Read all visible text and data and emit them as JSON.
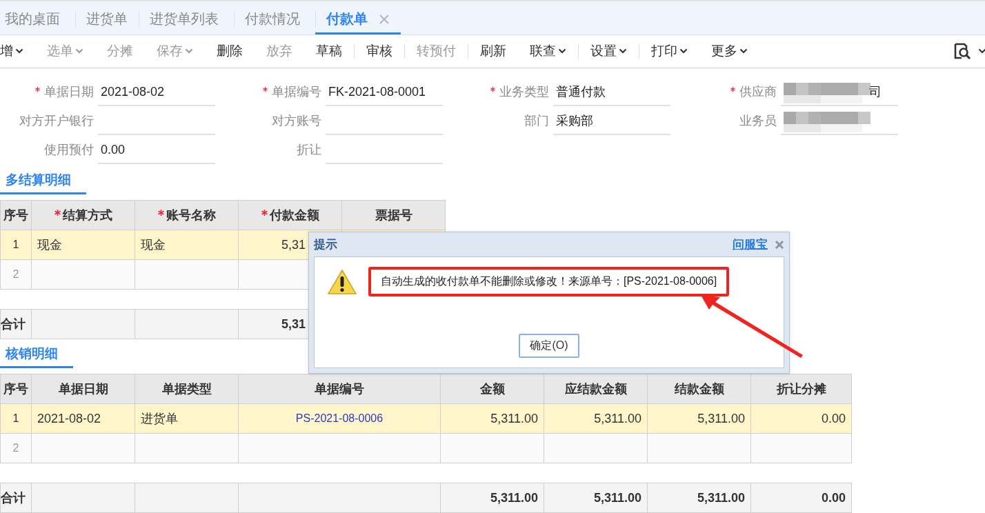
{
  "tabs": [
    {
      "label": "我的桌面",
      "selected": false,
      "closable": false
    },
    {
      "label": "进货单",
      "selected": false,
      "closable": false
    },
    {
      "label": "进货单列表",
      "selected": false,
      "closable": false
    },
    {
      "label": "付款情况",
      "selected": false,
      "closable": false
    },
    {
      "label": "付款单",
      "selected": true,
      "closable": true
    }
  ],
  "toolbar": {
    "items": [
      {
        "label": "增",
        "dropdown": true,
        "disabled": false,
        "separator_before": false
      },
      {
        "label": "选单",
        "dropdown": true,
        "disabled": true,
        "separator_before": false
      },
      {
        "label": "分摊",
        "dropdown": false,
        "disabled": true,
        "separator_before": false
      },
      {
        "label": "保存",
        "dropdown": true,
        "disabled": true,
        "separator_before": false
      },
      {
        "label": "删除",
        "dropdown": false,
        "disabled": false,
        "separator_before": false
      },
      {
        "label": "放弃",
        "dropdown": false,
        "disabled": true,
        "separator_before": false
      },
      {
        "label": "草稿",
        "dropdown": false,
        "disabled": false,
        "separator_before": false
      },
      {
        "label": "审核",
        "dropdown": false,
        "disabled": false,
        "separator_before": true
      },
      {
        "label": "转预付",
        "dropdown": false,
        "disabled": true,
        "separator_before": true
      },
      {
        "label": "刷新",
        "dropdown": false,
        "disabled": false,
        "separator_before": true
      },
      {
        "label": "联查",
        "dropdown": true,
        "disabled": false,
        "separator_before": false
      },
      {
        "label": "设置",
        "dropdown": true,
        "disabled": false,
        "separator_before": true
      },
      {
        "label": "打印",
        "dropdown": true,
        "disabled": false,
        "separator_before": true
      },
      {
        "label": "更多",
        "dropdown": true,
        "disabled": false,
        "separator_before": false
      }
    ]
  },
  "form": {
    "fields": [
      {
        "label": "单据日期",
        "required": true,
        "value": "2021-08-02",
        "redacted": false
      },
      {
        "label": "单据编号",
        "required": true,
        "value": "FK-2021-08-0001",
        "redacted": false
      },
      {
        "label": "业务类型",
        "required": true,
        "value": "普通付款",
        "redacted": false
      },
      {
        "label": "供应商",
        "required": true,
        "value": "司",
        "redacted": true
      },
      {
        "label": "对方开户银行",
        "required": false,
        "redacted": false
      },
      {
        "label": "对方账号",
        "required": false,
        "redacted": false
      },
      {
        "label": "部门",
        "required": false,
        "value": "采购部",
        "redacted": false
      },
      {
        "label": "业务员",
        "required": false,
        "redacted": true
      },
      {
        "label": "使用预付",
        "required": false,
        "value": "0.00",
        "redacted": false
      },
      {
        "label": "折让",
        "required": false,
        "redacted": false
      }
    ]
  },
  "sections": [
    {
      "title": "多结算明细",
      "columns": [
        {
          "label": "序号",
          "required": false,
          "kind": "index"
        },
        {
          "label": "结算方式",
          "required": true,
          "kind": "text"
        },
        {
          "label": "账号名称",
          "required": true,
          "kind": "text"
        },
        {
          "label": "付款金额",
          "required": true,
          "kind": "cut_amount"
        },
        {
          "label": "票据号",
          "required": false,
          "kind": "text"
        }
      ],
      "rows": [
        {
          "selected": true,
          "cells": [
            "1",
            "现金",
            "现金",
            "5,31"
          ]
        },
        {
          "selected": false,
          "cells": [
            "2"
          ]
        }
      ],
      "total": {
        "label": "合计",
        "amounts": [
          "5,31"
        ]
      }
    },
    {
      "title": "核销明细",
      "columns": [
        {
          "label": "序号",
          "required": false,
          "kind": "index"
        },
        {
          "label": "单据日期",
          "required": false,
          "kind": "text"
        },
        {
          "label": "单据类型",
          "required": false,
          "kind": "text"
        },
        {
          "label": "单据编号",
          "required": false,
          "kind": "link"
        },
        {
          "label": "金额",
          "required": false,
          "kind": "amount"
        },
        {
          "label": "应结款金额",
          "required": false,
          "kind": "amount"
        },
        {
          "label": "结款金额",
          "required": false,
          "kind": "amount"
        },
        {
          "label": "折让分摊",
          "required": false,
          "kind": "amount"
        }
      ],
      "rows": [
        {
          "selected": true,
          "cells": [
            "1",
            "2021-08-02",
            "进货单",
            "PS-2021-08-0006",
            "5,311.00",
            "5,311.00",
            "5,311.00",
            "0.00"
          ]
        },
        {
          "selected": false,
          "cells": [
            "2"
          ]
        }
      ],
      "total": {
        "label": "合计",
        "amounts": [
          "5,311.00",
          "5,311.00",
          "5,311.00",
          "0.00"
        ]
      }
    }
  ],
  "dialog": {
    "title": "提示",
    "help_link": "问服宝",
    "message": "自动生成的收付款单不能删除或修改！来源单号：[PS-2021-08-0006]",
    "button": "确定(O)"
  }
}
